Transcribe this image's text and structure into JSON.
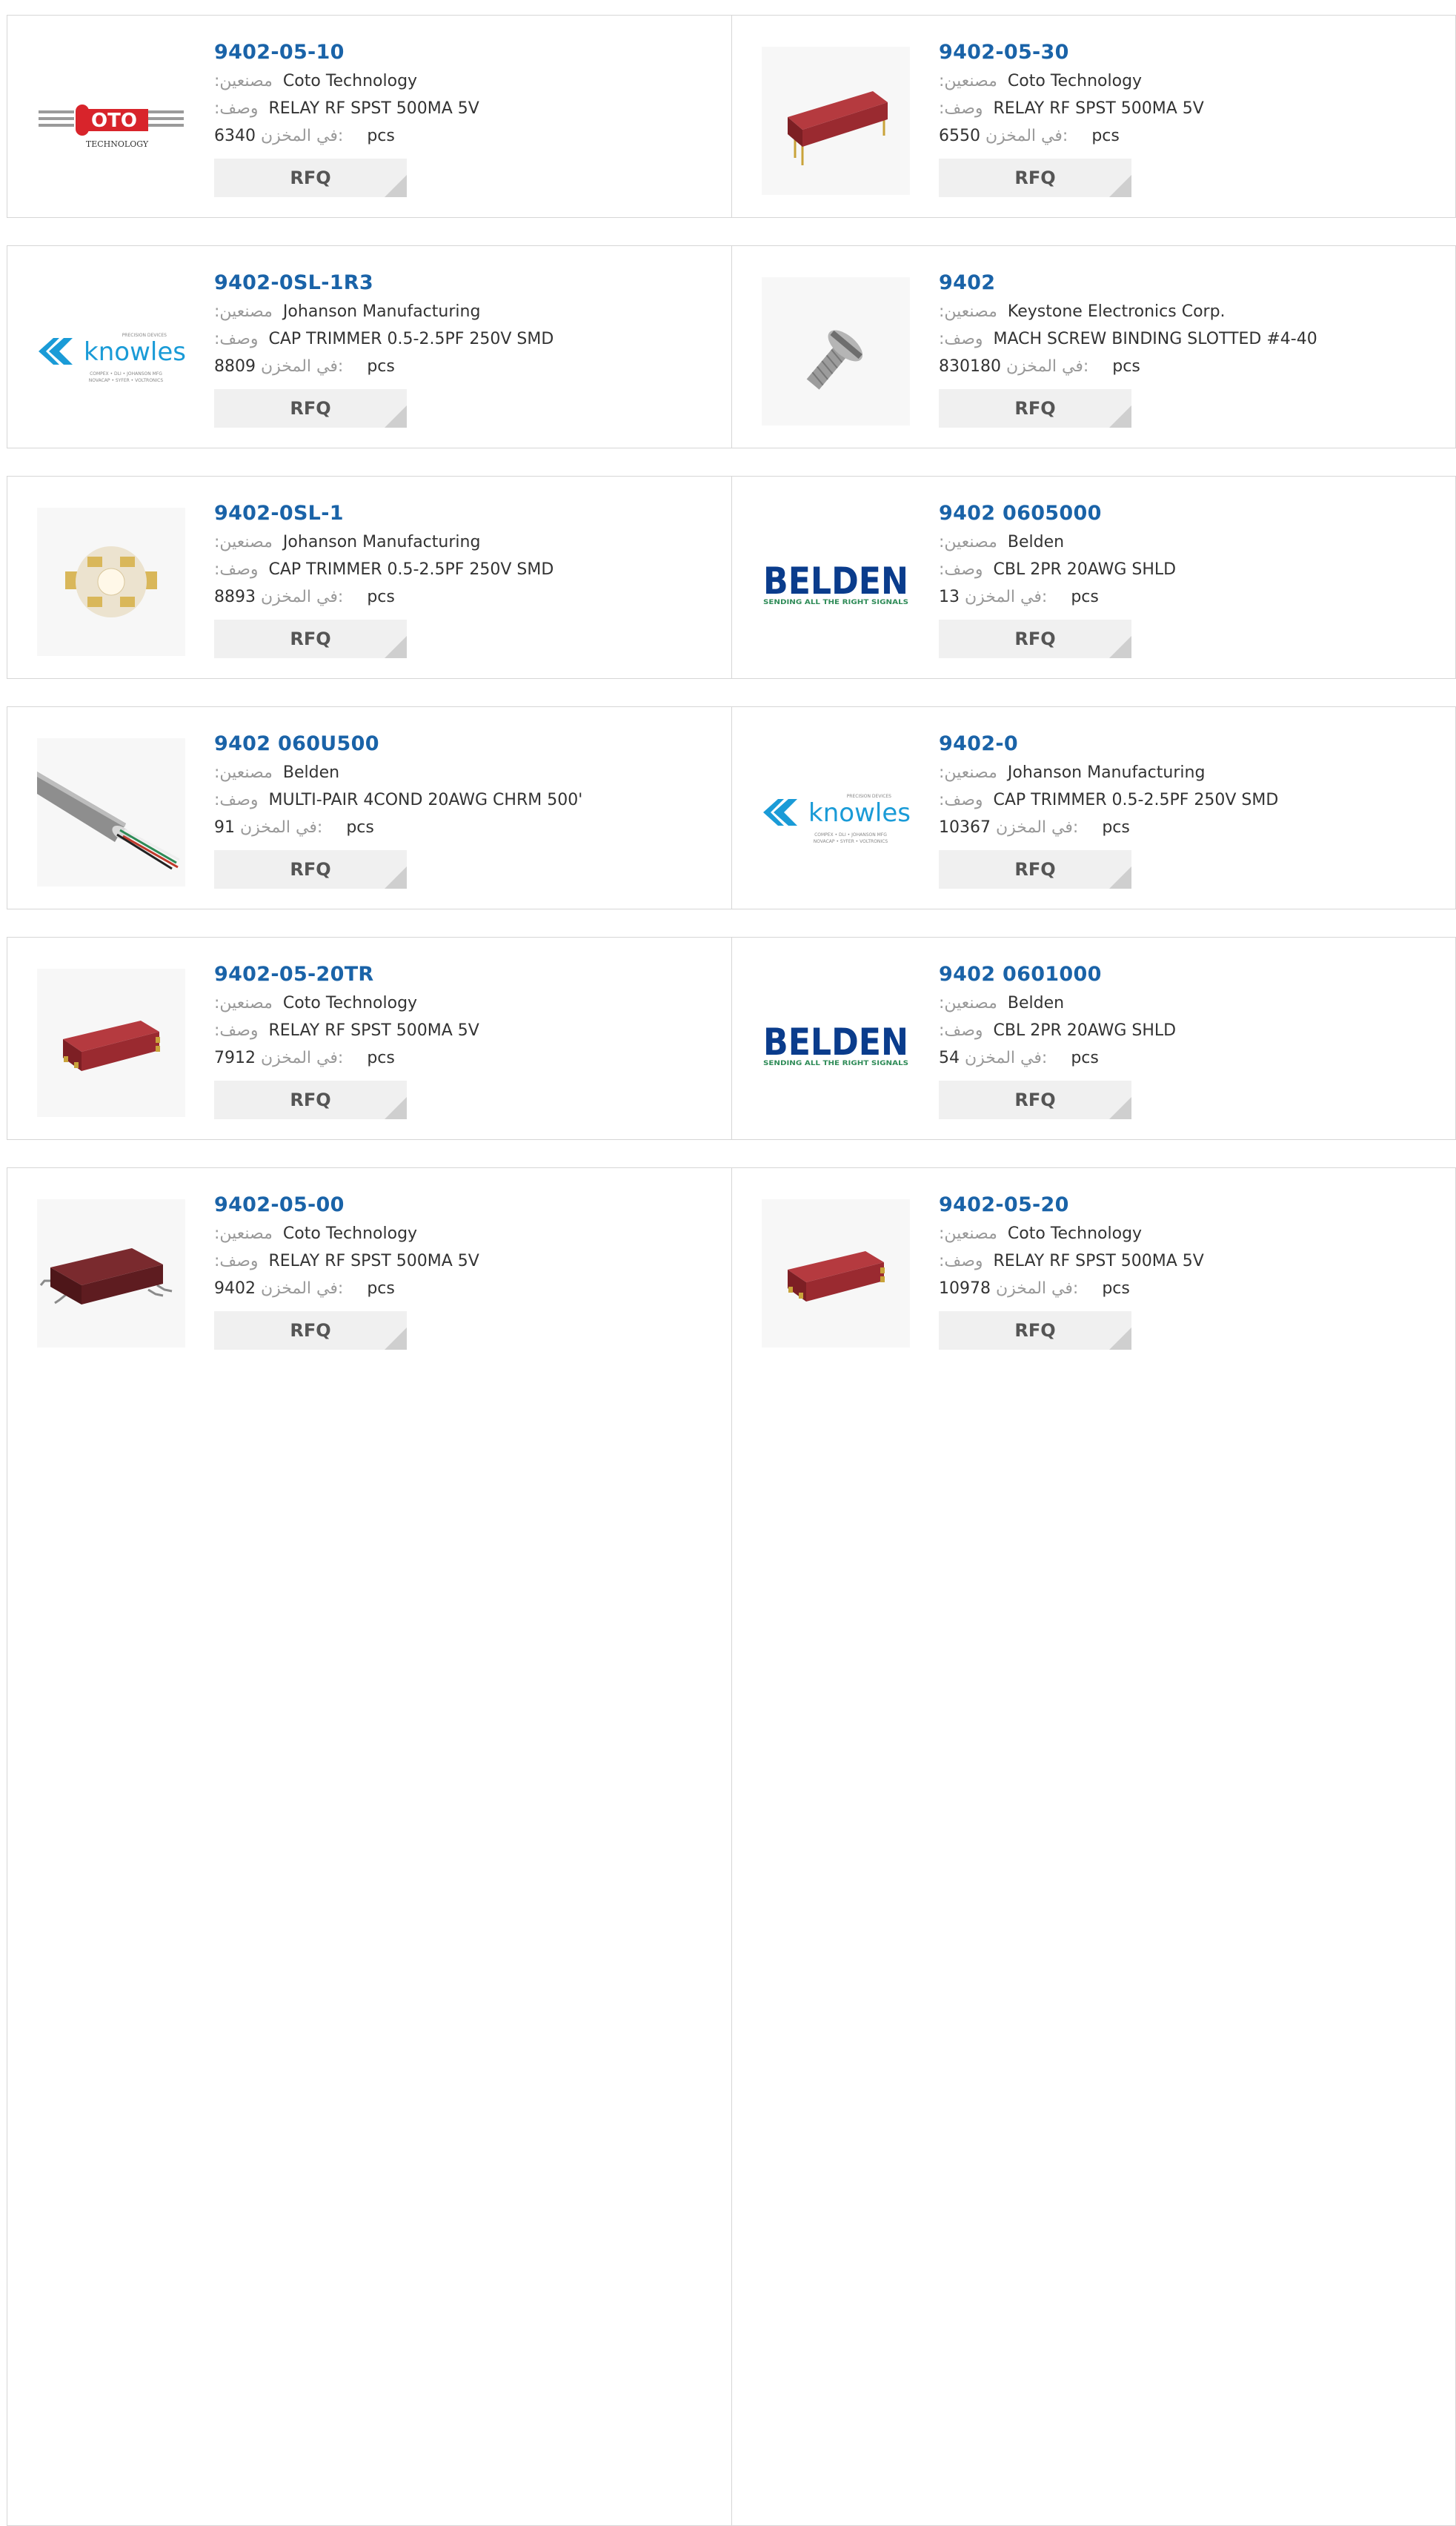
{
  "labels": {
    "manufacturer": ":مصنعين",
    "description": ":وصف",
    "stock": "في المخزن:",
    "unit": "pcs",
    "rfq": "RFQ"
  },
  "colors": {
    "part_number": "#1a63a8",
    "border": "#d6d6d6",
    "button_bg": "#f0f0f0",
    "label": "#999999"
  },
  "rows": [
    {
      "items": [
        {
          "part_number": "9402-05-10",
          "manufacturer": "Coto Technology",
          "description": "RELAY RF SPST 500MA 5V",
          "stock": "6340",
          "image": "coto-logo"
        },
        {
          "part_number": "9402-05-30",
          "manufacturer": "Coto Technology",
          "description": "RELAY RF SPST 500MA 5V",
          "stock": "6550",
          "image": "red-relay-through-hole"
        }
      ]
    },
    {
      "items": [
        {
          "part_number": "9402-0SL-1R3",
          "manufacturer": "Johanson Manufacturing",
          "description": "CAP TRIMMER 0.5-2.5PF 250V SMD",
          "stock": "8809",
          "image": "knowles-logo"
        },
        {
          "part_number": "9402",
          "manufacturer": "Keystone Electronics Corp.",
          "description": "MACH SCREW BINDING SLOTTED #4-40",
          "stock": "830180",
          "image": "machine-screw"
        }
      ]
    },
    {
      "items": [
        {
          "part_number": "9402-0SL-1",
          "manufacturer": "Johanson Manufacturing",
          "description": "CAP TRIMMER 0.5-2.5PF 250V SMD",
          "stock": "8893",
          "image": "trimmer-capacitor"
        },
        {
          "part_number": "9402 0605000",
          "manufacturer": "Belden",
          "description": "CBL 2PR 20AWG SHLD",
          "stock": "13",
          "image": "belden-logo"
        }
      ]
    },
    {
      "items": [
        {
          "part_number": "9402 060U500",
          "manufacturer": "Belden",
          "description": "MULTI-PAIR 4COND 20AWG CHRM 500'",
          "stock": "91",
          "image": "gray-cable"
        },
        {
          "part_number": "9402-0",
          "manufacturer": "Johanson Manufacturing",
          "description": "CAP TRIMMER 0.5-2.5PF 250V SMD",
          "stock": "10367",
          "image": "knowles-logo"
        }
      ]
    },
    {
      "items": [
        {
          "part_number": "9402-05-20TR",
          "manufacturer": "Coto Technology",
          "description": "RELAY RF SPST 500MA 5V",
          "stock": "7912",
          "image": "red-relay-smd"
        },
        {
          "part_number": "9402 0601000",
          "manufacturer": "Belden",
          "description": "CBL 2PR 20AWG SHLD",
          "stock": "54",
          "image": "belden-logo"
        }
      ]
    },
    {
      "items": [
        {
          "part_number": "9402-05-00",
          "manufacturer": "Coto Technology",
          "description": "RELAY RF SPST 500MA 5V",
          "stock": "9402",
          "image": "dark-relay-gullwing"
        },
        {
          "part_number": "9402-05-20",
          "manufacturer": "Coto Technology",
          "description": "RELAY RF SPST 500MA 5V",
          "stock": "10978",
          "image": "red-relay-smd"
        }
      ]
    }
  ],
  "logos": {
    "coto": {
      "main": "OTO",
      "sub": "TECHNOLOGY"
    },
    "knowles": {
      "main": "knowles",
      "tag": "PRECISION DEVICES",
      "sub1": "COMPEX • DLI • JOHANSON MFG",
      "sub2": "NOVACAP • SYFER • VOLTRONICS"
    },
    "belden": {
      "main": "BELDEN",
      "sub": "SENDING ALL THE RIGHT SIGNALS"
    }
  }
}
